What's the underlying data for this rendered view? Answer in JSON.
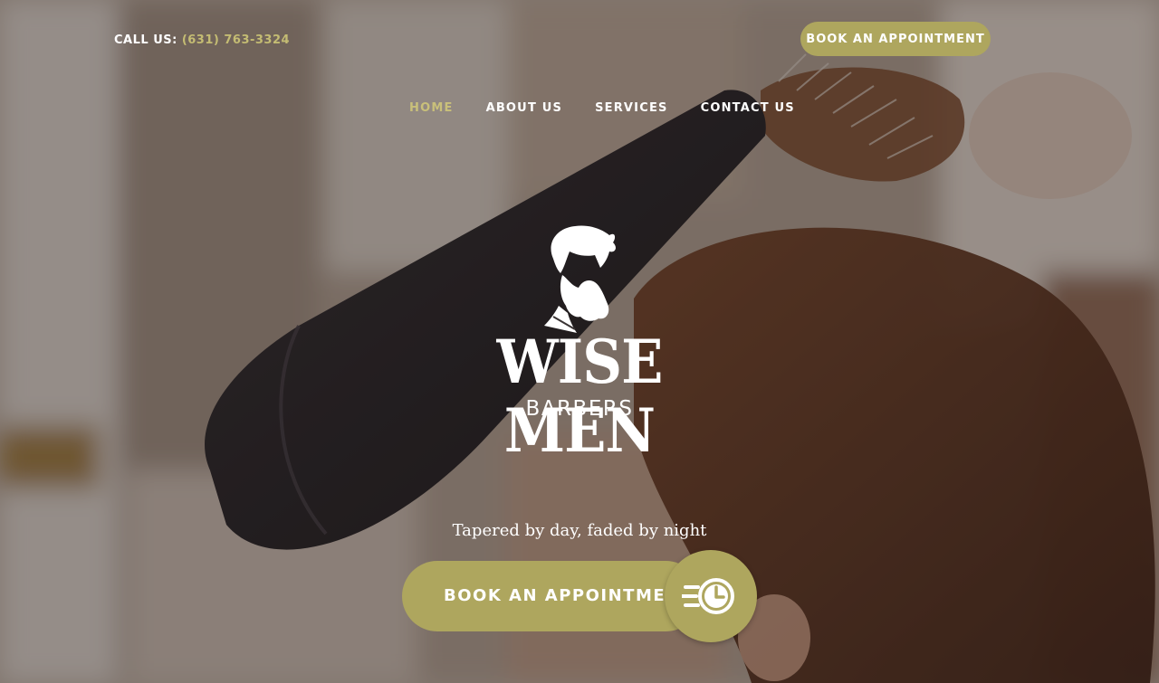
{
  "header": {
    "call_label": "CALL US:",
    "phone": "(631) 763-3324",
    "book_button": "BOOK AN APPOINTMENT"
  },
  "nav": {
    "items": [
      {
        "label": "HOME",
        "active": true
      },
      {
        "label": "ABOUT US",
        "active": false
      },
      {
        "label": "SERVICES",
        "active": false
      },
      {
        "label": "CONTACT US",
        "active": false
      }
    ]
  },
  "brand": {
    "logo_icon": "bearded-man-icon",
    "title": "WISE MEN",
    "subtitle": "BARBERS"
  },
  "hero": {
    "tagline": "Tapered by day, faded by night",
    "cta_label": "BOOK AN APPOINTMENT",
    "cta_icon": "fast-clock-icon"
  },
  "colors": {
    "accent": "#aea65e",
    "accent_text": "#c4bc73",
    "text": "#ffffff"
  }
}
